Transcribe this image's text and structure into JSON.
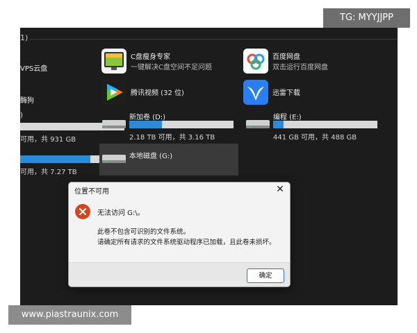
{
  "watermark": {
    "tag": "TG: MYYJJPP",
    "url": "www.piastraunix.com"
  },
  "group": {
    "header": "1)"
  },
  "apps": [
    {
      "name": "C盘瘦身专家",
      "sub": "一键解决C盘空间不足问题",
      "icon": "c-drive-cleaner-icon"
    },
    {
      "name": "百度网盘",
      "sub": "双击运行百度网盘",
      "icon": "baidu-netdisk-icon"
    },
    {
      "name": "腾讯视频 (32 位)",
      "sub": "",
      "icon": "tencent-video-icon"
    },
    {
      "name": "迅雷下载",
      "sub": "",
      "icon": "xunlei-icon"
    }
  ],
  "partial": {
    "wps": "VPS云盘",
    "label2": "酶狗",
    "paren": ")"
  },
  "drives": [
    {
      "name": "",
      "free": "可用，共 931 GB",
      "usage": 0
    },
    {
      "name": "新加卷 (D:)",
      "free": "2.18 TB 可用，共 3.16 TB",
      "usage": 0.31
    },
    {
      "name": "编程 (E:)",
      "free": "441 GB 可用，共 488 GB",
      "usage": 0.1
    },
    {
      "name": "",
      "free": "可用，共 7.27 TB",
      "usage": 0.67
    },
    {
      "name": "本地磁盘 (G:)",
      "free": "",
      "usage": null
    }
  ],
  "dialog": {
    "title": "位置不可用",
    "message_main": "无法访问 G:\\。",
    "message_line1": "此卷不包含可识别的文件系统。",
    "message_line2": "请确定所有请求的文件系统驱动程序已加载，且此卷未损坏。",
    "ok_label": "确定"
  },
  "colors": {
    "usage_bar": "#2d8ad8",
    "error": "#d4461f",
    "ok_border": "#3a6fb8"
  }
}
